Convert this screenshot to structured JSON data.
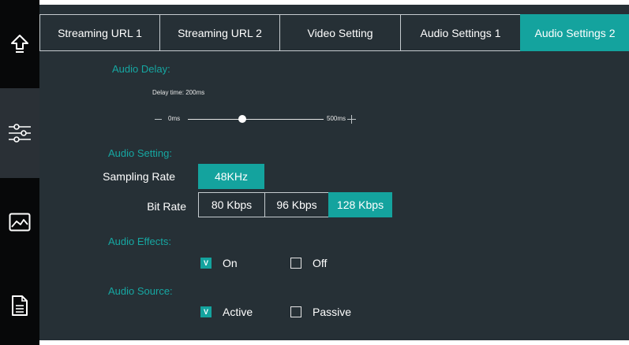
{
  "sidebar": {
    "items": [
      {
        "icon": "upload-arrow-icon"
      },
      {
        "icon": "sliders-icon"
      },
      {
        "icon": "image-icon"
      },
      {
        "icon": "document-icon"
      }
    ]
  },
  "tabs": [
    {
      "label": "Streaming URL 1",
      "active": false
    },
    {
      "label": "Streaming URL 2",
      "active": false
    },
    {
      "label": "Video Setting",
      "active": false
    },
    {
      "label": "Audio Settings 1",
      "active": false
    },
    {
      "label": "Audio Settings 2",
      "active": true
    }
  ],
  "audio_delay": {
    "title": "Audio Delay:",
    "delay_text": "Delay time: 200ms",
    "min_label": "0ms",
    "max_label": "500ms",
    "value_fraction": 0.4
  },
  "audio_setting": {
    "title": "Audio Setting:",
    "sampling_label": "Sampling Rate",
    "sampling_options": [
      "48KHz"
    ],
    "bit_label": "Bit Rate",
    "bit_options": [
      "80 Kbps",
      "96 Kbps",
      "128 Kbps"
    ],
    "bit_selected": "128 Kbps"
  },
  "audio_effects": {
    "title": "Audio Effects:",
    "on_label": "On",
    "off_label": "Off",
    "checked_mark": "V"
  },
  "audio_source": {
    "title": "Audio Source:",
    "active_label": "Active",
    "passive_label": "Passive",
    "checked_mark": "V"
  },
  "colors": {
    "accent": "#14a39e",
    "panel": "#263036",
    "section_title": "#16a7a2"
  }
}
